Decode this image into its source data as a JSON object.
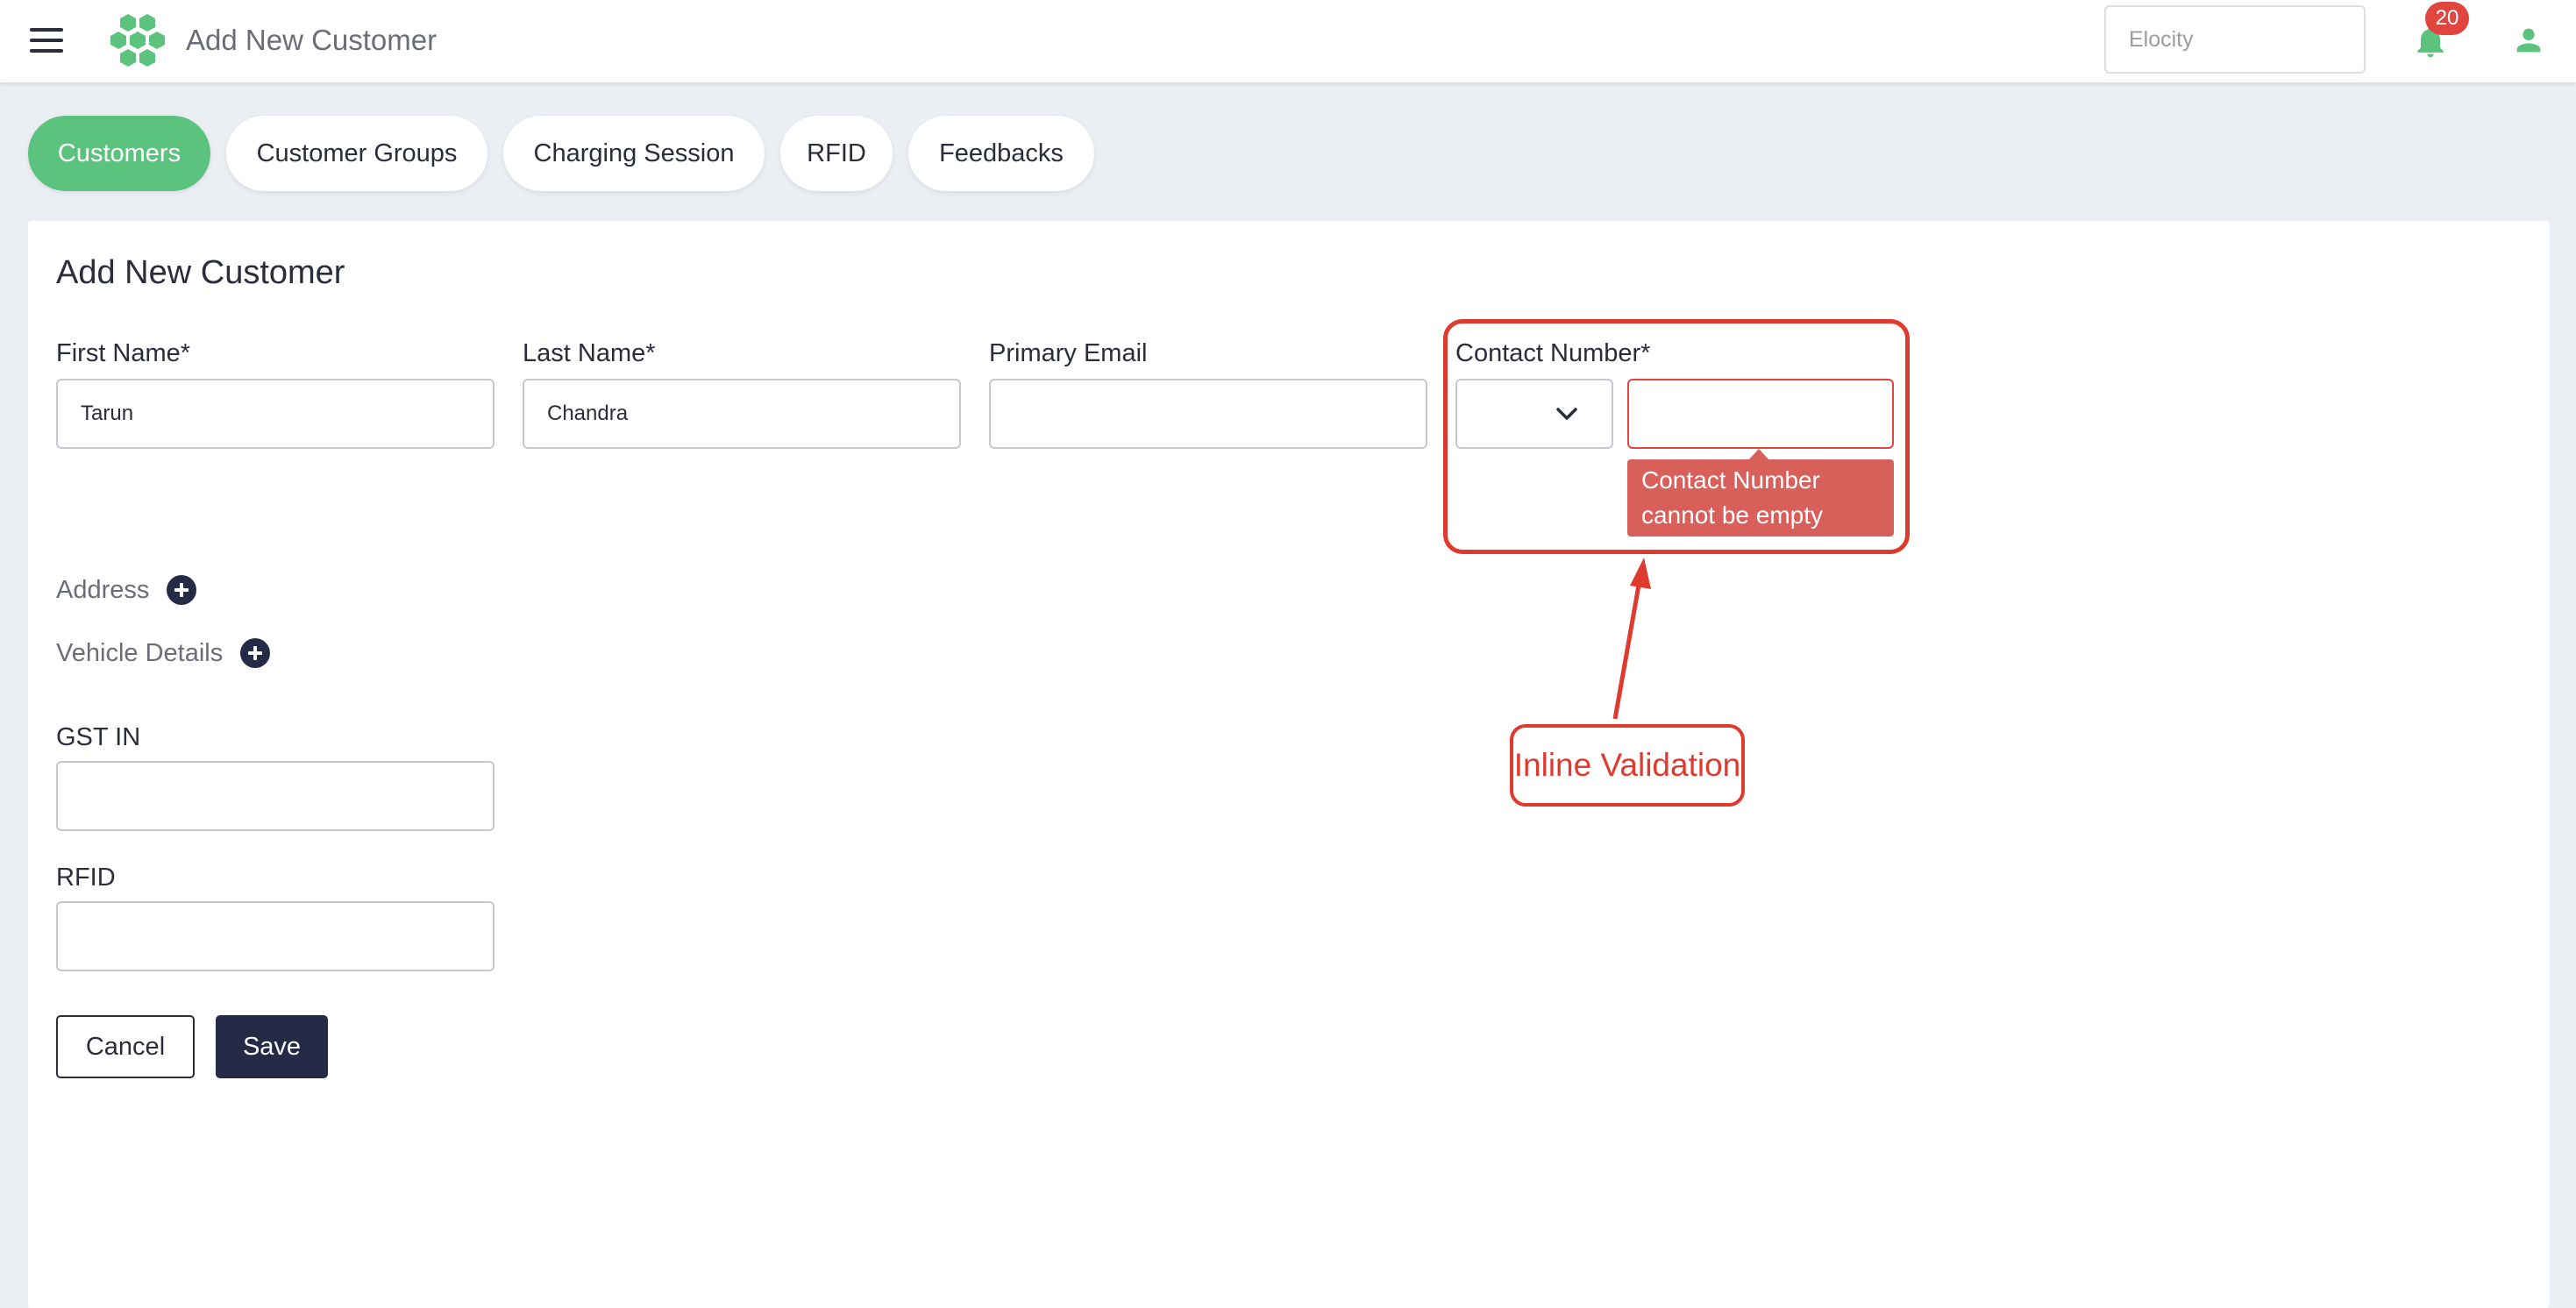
{
  "header": {
    "title": "Add New Customer",
    "org_selector": "Elocity",
    "notification_count": "20",
    "brand_color": "#5cc37e"
  },
  "tabs": [
    {
      "label": "Customers",
      "active": true
    },
    {
      "label": "Customer Groups",
      "active": false
    },
    {
      "label": "Charging Session",
      "active": false
    },
    {
      "label": "RFID",
      "active": false
    },
    {
      "label": "Feedbacks",
      "active": false
    }
  ],
  "form": {
    "title": "Add New Customer",
    "first_name": {
      "label": "First Name*",
      "value": "Tarun"
    },
    "last_name": {
      "label": "Last Name*",
      "value": "Chandra"
    },
    "primary_email": {
      "label": "Primary Email",
      "value": ""
    },
    "contact_number": {
      "label": "Contact Number*",
      "country_code": "",
      "value": "",
      "error": "Contact Number cannot be empty",
      "error_color": "#d9605a"
    },
    "address_label": "Address",
    "vehicle_details_label": "Vehicle Details",
    "gst_in": {
      "label": "GST IN",
      "value": ""
    },
    "rfid": {
      "label": "RFID",
      "value": ""
    },
    "cancel_label": "Cancel",
    "save_label": "Save"
  },
  "annotation": {
    "text": "Inline Validation",
    "color": "#e0392e"
  }
}
